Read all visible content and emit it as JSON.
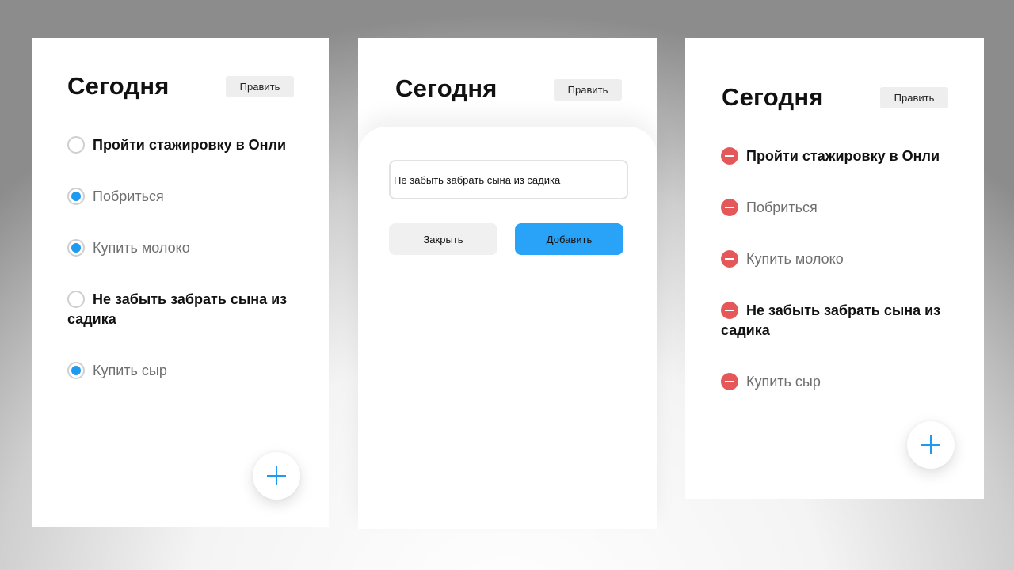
{
  "screens": [
    {
      "title": "Сегодня",
      "edit_label": "Править",
      "tasks": [
        {
          "text": "Пройти стажировку в Онли",
          "done": false
        },
        {
          "text": "Побриться",
          "done": true
        },
        {
          "text": "Купить молоко",
          "done": true
        },
        {
          "text": "Не забыть забрать сына из садика",
          "done": false
        },
        {
          "text": "Купить сыр",
          "done": true
        }
      ]
    },
    {
      "title": "Сегодня",
      "edit_label": "Править",
      "input_value": "Не забыть забрать сына из садика",
      "close_label": "Закрыть",
      "add_label": "Добавить"
    },
    {
      "title": "Сегодня",
      "edit_label": "Править",
      "tasks": [
        {
          "text": "Пройти стажировку в Онли",
          "done": false
        },
        {
          "text": "Побриться",
          "done": true
        },
        {
          "text": "Купить молоко",
          "done": true
        },
        {
          "text": "Не забыть забрать сына из садика",
          "done": false
        },
        {
          "text": "Купить сыр",
          "done": true
        }
      ]
    }
  ],
  "icons": {
    "unchecked": "radio-unchecked-icon",
    "checked": "radio-checked-icon",
    "remove": "remove-circle-icon",
    "add": "plus-icon"
  },
  "colors": {
    "accent": "#1e9bf0",
    "add_button": "#29a3f7",
    "remove": "#e5585a",
    "done_text": "#6f6f6f"
  }
}
